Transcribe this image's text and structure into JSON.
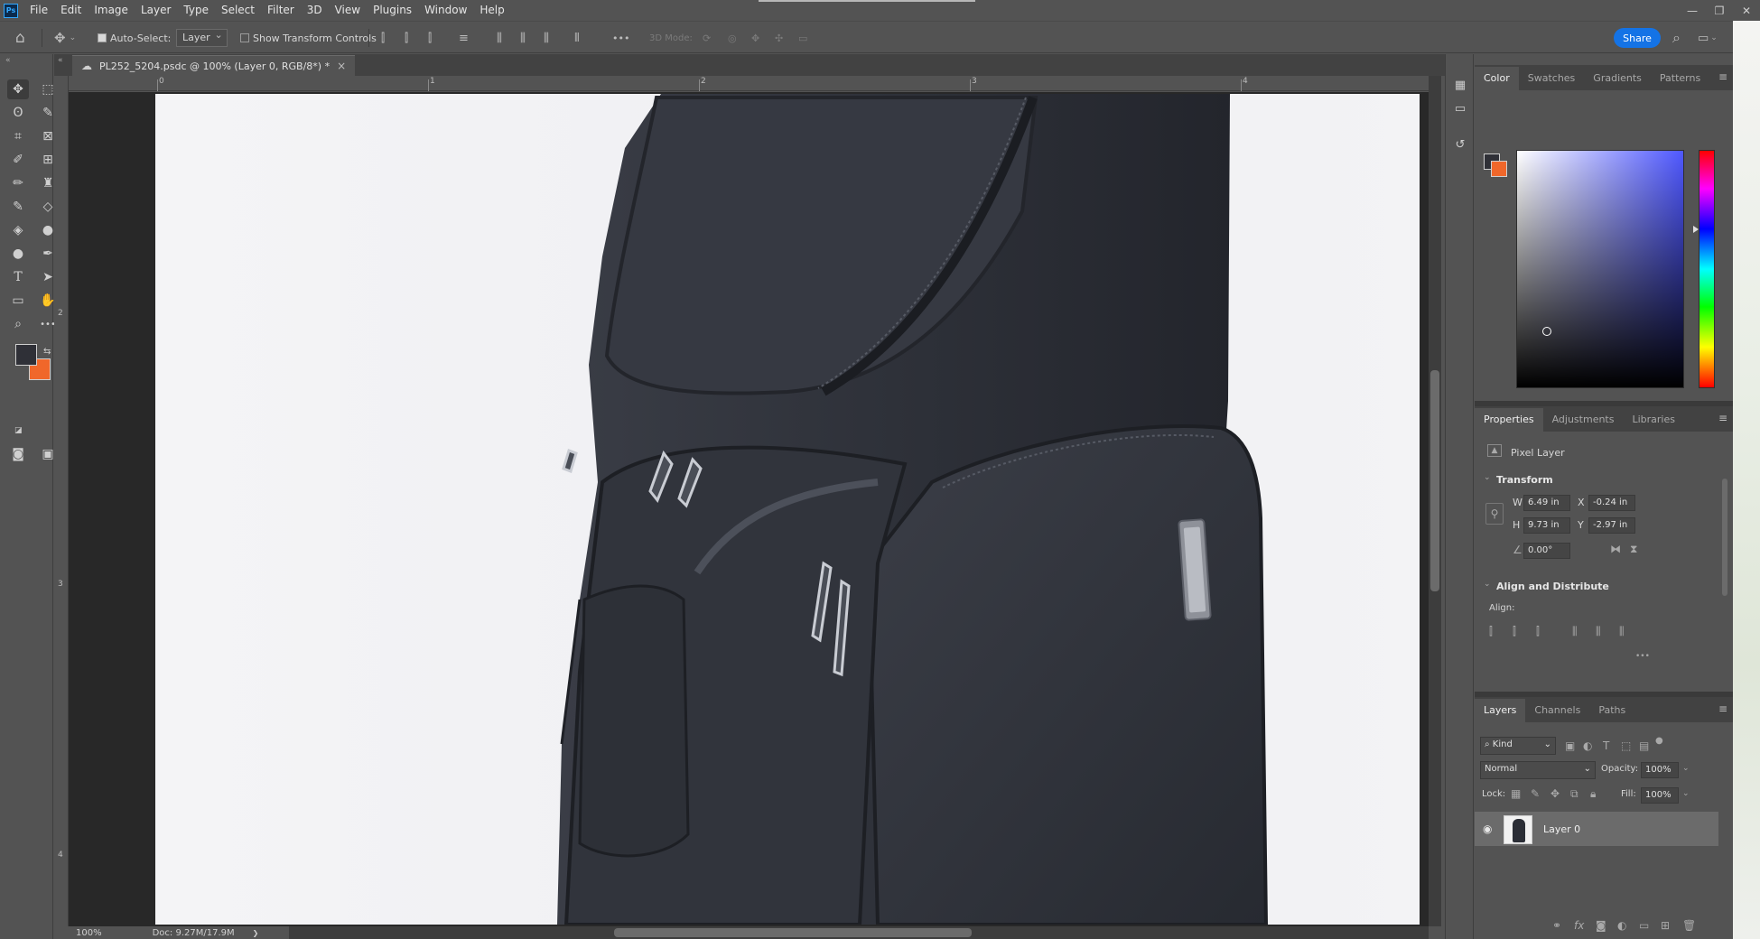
{
  "app": {
    "logo": "Ps"
  },
  "menu": [
    "File",
    "Edit",
    "Image",
    "Layer",
    "Type",
    "Select",
    "Filter",
    "3D",
    "View",
    "Plugins",
    "Window",
    "Help"
  ],
  "window_controls": {
    "minimize": "—",
    "restore": "❐",
    "close": "✕"
  },
  "options": {
    "auto_select_label": "Auto-Select:",
    "auto_select_value": "Layer",
    "show_transform_label": "Show Transform Controls",
    "mode_3d_label": "3D Mode:",
    "more": "•••",
    "share": "Share"
  },
  "document": {
    "tab_title": "PL252_5204.psdc @ 100% (Layer 0, RGB/8*) *",
    "close": "×"
  },
  "rulers": {
    "top": [
      "0",
      "1",
      "2",
      "3",
      "4"
    ],
    "left": [
      "2",
      "3",
      "4"
    ]
  },
  "status": {
    "zoom": "100%",
    "doc": "Doc: 9.27M/17.9M",
    "arrow": "❯"
  },
  "colors": {
    "foreground": "#2f3037",
    "background": "#f0672a",
    "accent": "#1473e6"
  },
  "color_panel": {
    "tabs": [
      "Color",
      "Swatches",
      "Gradients",
      "Patterns"
    ],
    "active": 0
  },
  "properties_panel": {
    "tabs": [
      "Properties",
      "Adjustments",
      "Libraries"
    ],
    "layer_type": "Pixel Layer",
    "transform_title": "Transform",
    "w_label": "W",
    "w_value": "6.49 in",
    "h_label": "H",
    "h_value": "9.73 in",
    "x_label": "X",
    "x_value": "-0.24 in",
    "y_label": "Y",
    "y_value": "-2.97 in",
    "angle_value": "0.00°",
    "align_title": "Align and Distribute",
    "align_label": "Align:",
    "more": "•••"
  },
  "layers_panel": {
    "tabs": [
      "Layers",
      "Channels",
      "Paths"
    ],
    "filter_kind": "Kind",
    "blend_mode": "Normal",
    "opacity_label": "Opacity:",
    "opacity_value": "100%",
    "lock_label": "Lock:",
    "fill_label": "Fill:",
    "fill_value": "100%",
    "layers": [
      {
        "name": "Layer 0",
        "visible": true
      }
    ]
  },
  "icons": {
    "home": "⌂",
    "move": "✥",
    "marquee": "⬚",
    "lasso": "ʘ",
    "quick_select": "✎",
    "crop": "⌗",
    "frame": "⊠",
    "eyedropper": "✐",
    "patch": "⊞",
    "brush": "✏",
    "stamp": "♜",
    "history_brush": "✎",
    "eraser": "◇",
    "bucket": "◈",
    "blur": "●",
    "dodge": "●",
    "pen": "✒",
    "type": "T",
    "path_select": "➤",
    "rectangle": "▭",
    "hand": "✋",
    "zoom": "⌕",
    "more": "•••",
    "quick_mask": "◙",
    "screen_mode": "▣",
    "search": "⌕",
    "workspace": "▭",
    "eye": "◉",
    "link": "⚲",
    "menu": "≡"
  }
}
